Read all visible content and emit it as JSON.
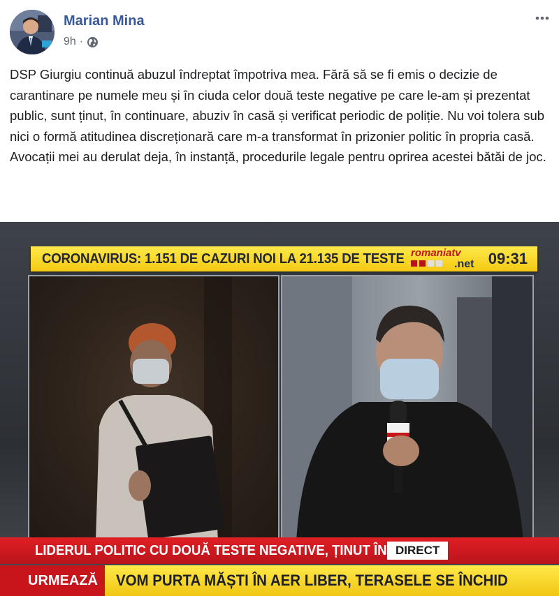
{
  "post": {
    "author": "Marian Mina",
    "time": "9h",
    "separator": "·",
    "privacy_icon": "globe-icon",
    "more_icon": "more-horizontal-icon",
    "text": "DSP Giurgiu continuă abuzul îndreptat împotriva mea. Fără să se fi emis o decizie de carantinare pe numele meu și în ciuda celor două teste negative pe care le-am și prezentat public, sunt ținut, în continuare, abuziv în casă și verificat periodic de poliție. Nu voi tolera sub nici o formă atitudinea discreționară care m-a transformat în prizonier politic în propria casă. Avocații mei au derulat deja, în instanță, procedurile legale pentru oprirea acestei bătăi de joc."
  },
  "video": {
    "top_headline": "CORONAVIRUS: 1.151 DE CAZURI NOI LA 21.135 DE TESTE",
    "logo_top": "romaniatv",
    "logo_bottom": ".net",
    "clock": "09:31",
    "lower_third": "LIDERUL POLITIC CU DOUĂ TESTE NEGATIVE, ȚINUT ÎN CASĂ",
    "live_tag": "DIRECT",
    "next_tag": "URMEAZĂ",
    "next_headline": "VOM PURTA MĂȘTI ÎN AER LIBER, TERASELE SE ÎNCHID"
  },
  "colors": {
    "link_blue": "#385898",
    "ticker_yellow": "#f3c913",
    "banner_red": "#c8151c"
  }
}
